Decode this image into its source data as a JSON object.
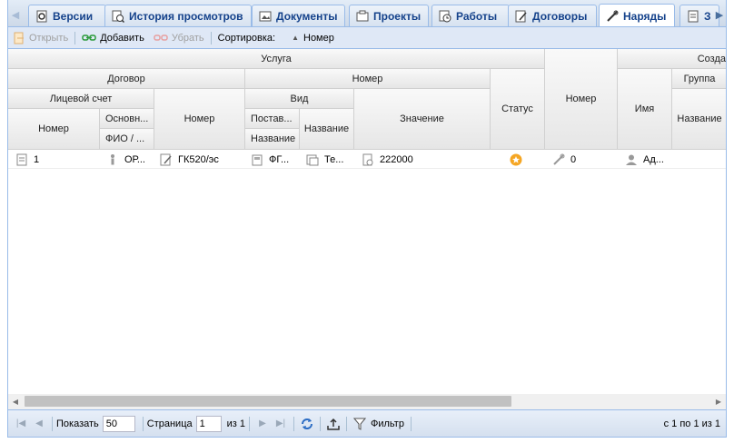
{
  "tabs": [
    {
      "label": "Версии",
      "icon": "versions-icon"
    },
    {
      "label": "История просмотров",
      "icon": "history-icon"
    },
    {
      "label": "Документы",
      "icon": "documents-icon"
    },
    {
      "label": "Проекты",
      "icon": "projects-icon"
    },
    {
      "label": "Работы",
      "icon": "works-icon"
    },
    {
      "label": "Договоры",
      "icon": "contracts-icon"
    },
    {
      "label": "Наряды",
      "icon": "orders-icon",
      "active": true
    },
    {
      "label": "З",
      "icon": "next-tab-icon"
    }
  ],
  "toolbar": {
    "open_label": "Открыть",
    "add_label": "Добавить",
    "remove_label": "Убрать",
    "sort_label": "Сортировка:",
    "sort_field": "Номер"
  },
  "grid": {
    "headers": {
      "usluga": "Услуга",
      "sozdal": "Созда",
      "dogovor": "Договор",
      "nomer_group": "Номер",
      "gruppa": "Группа",
      "licevoy": "Лицевой счет",
      "vid": "Вид",
      "status": "Статус",
      "nomer_col": "Номер",
      "imya": "Имя",
      "ls_nomer": "Номер",
      "osnovn": "Основн...",
      "fio": "ФИО / ...",
      "dog_nomer": "Номер",
      "postav": "Постав...",
      "postav_name": "Название",
      "vid_name": "Название",
      "znachenie": "Значение",
      "gruppa_name": "Название"
    },
    "rows": [
      {
        "ls_nomer": "1",
        "osnovn": "ОР...",
        "dog_nomer": "ГК520/эс",
        "postav": "ФГ...",
        "vid_name": "Те...",
        "znachenie": "222000",
        "nomer": "0",
        "imya": "Ад..."
      }
    ]
  },
  "pager": {
    "show_label": "Показать",
    "page_size": "50",
    "page_label": "Страница",
    "page_value": "1",
    "of_label": "из 1",
    "filter_label": "Фильтр",
    "summary": "с 1 по 1 из 1"
  },
  "colors": {
    "accent": "#15428b",
    "border": "#99bbe8",
    "status": "#f5a623"
  }
}
